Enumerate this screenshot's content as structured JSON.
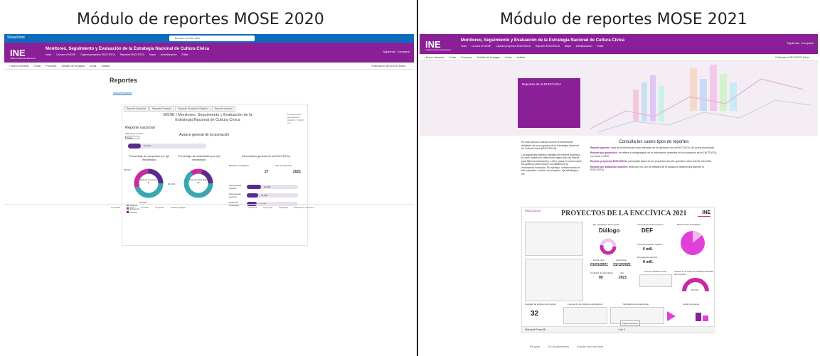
{
  "titles": {
    "left": "Módulo de reportes MOSE 2020",
    "right": "Módulo de reportes MOSE 2021"
  },
  "colors": {
    "purple": "#8a1f97",
    "blue": "#0f6cbd",
    "dark_purple": "#5a2b8a",
    "teal": "#3aa7b0",
    "magenta": "#c72ba0"
  },
  "left": {
    "brand": "SharePoint",
    "search_placeholder": "Buscar en este sitio",
    "header": {
      "logo": "INE",
      "logo_sub": "Instituto Nacional Electoral",
      "title": "Monitoreo, Seguimiento y Evaluación de la Estrategia Nacional de Cultura Cívica",
      "nav": [
        "Inicio",
        "Conoce el MOSE",
        "Captura proyectos ENCCÍVICA",
        "Reportes ENCCÍVICA",
        "Mapa",
        "Administración",
        "Editar"
      ],
      "right": [
        "Siguiendo",
        "Compartir"
      ]
    },
    "cmd": [
      "+ Nuevo elemento",
      "Enviar",
      "Promover",
      "Detalles de la página",
      "Iniciar",
      "Análisis"
    ],
    "cmd_right": "Publicado el 28/10/2021   Editar",
    "page_title": "Reportes",
    "back_link": "Inicio/Reportes",
    "tabs": [
      "Reporte Nacional",
      "Reporte Proyecto",
      "Reporte Población Objetivo",
      "Reporte Actores"
    ],
    "card_title": "MOSE | Monitoreo, Seguimiento y Evaluación de la Estrategia Nacional de Cultura Cívica",
    "card_ts": "Fecha/Hora de actualización 09/02/21 7:00:00 p.m.",
    "rn": "Reporte nacional",
    "sel_label": "Seleccione un año",
    "sel_value": "Todos",
    "avance": "Avance general de la operación",
    "avance_pct": "16.46%",
    "donut1_title": "Porcentaje de proyectos por eje estratégico",
    "donut1_center": "Total de proyectos",
    "donut1_num": "31",
    "donut2_title": "Porcentaje de actividades por eje estratégico",
    "donut2_center": "Total de actividades",
    "donut2_num": "62",
    "d1_labels": [
      "25.81%",
      "45.16%",
      "29.03%"
    ],
    "info_title": "Información general de la ENCCÍVICA",
    "info_h1": "Medición estratégica",
    "info_h2": "Año de operación",
    "info_v1": "27",
    "info_v2": "2021",
    "bars": [
      {
        "label": "Participantes directos",
        "value": "12,346"
      },
      {
        "label": "Presupuesto ejercido",
        "value": "13,986"
      },
      {
        "label": "Población alcanzada",
        "value": "14,099"
      }
    ],
    "legend": [
      "Diálogo",
      "Exigencia",
      "Verdad"
    ],
    "footer": [
      "Comentar",
      "Te gusta",
      "Guardar",
      "Compartir",
      "Publicar página"
    ],
    "footer_right": [
      "Informes",
      "Comparte",
      "Mensajes",
      "Elementos recientes"
    ]
  },
  "right": {
    "header": {
      "logo": "INE",
      "logo_sub": "Instituto Nacional Electoral",
      "title": "Monitoreo, Seguimiento y Evaluación de la Estrategia Nacional de Cultura Cívica",
      "nav": [
        "Inicio",
        "Conoce el MOSE",
        "Captura proyectos ENCCÍVICA",
        "Reportes ENCCÍVICA",
        "Mapa",
        "Administración",
        "Editar"
      ],
      "right": [
        "Siguiendo",
        "Compartir"
      ]
    },
    "cmd": [
      "+ Nuevo elemento",
      "Enviar",
      "Promover",
      "Detalles de la página",
      "Iniciar",
      "Análisis"
    ],
    "cmd_right": "Publicado el 28/10/2021   Editar",
    "hero_box": "Reportes de la ENCCÍVICA",
    "intro": "En esta sección podrás conocer la información detallada de los proyectos de la Estrategia Nacional de Cultura Cívica (ENCCÍVICA).",
    "intro2": "Los siguientes tableros trabajan de manera dinámica, es decir, basta con seleccionar algún dato de interés para filtrar la información, o bien, pasar el cursor sobre los gráficos para conocer los detalles de la información mostrada. Por ejemplo, seleccionando el año operativo, nombre del proyecto, eje estratégico, etc.",
    "consulta_title": "Consulta los cuatro tipos de reportes:",
    "items": [
      {
        "b": "Reporte general:",
        "t": "trata de la información más relevante de la operación de la ENCCÍVICA, de forma acumulada."
      },
      {
        "b": "Reporte por proyectos:",
        "t": "se refiere al desagregado de la información operativa de los proyectos de la ENCCÍVICA, con corte a 2020."
      },
      {
        "b": "Reporte proyectos ENCCÍVICA:",
        "t": "principales datos de los proyectos del año operativo más reciente año 2021."
      },
      {
        "b": "Reporte por población objetivo:",
        "t": "tiene que ver con los detalles de la población objetivo que atiende la ENCCÍVICA."
      }
    ],
    "pbi_title": "PROYECTOS DE LA ENCCÍVICA 2021",
    "pbi_logo": "ENCCÍVICA",
    "pbi_ine": "INE",
    "eje_label": "Eje estratégico del proyecto",
    "eje_val": "Diálogo",
    "area_label": "Área ejecutora del proyecto",
    "area_val": "DEF",
    "meta_label": "Metas de las actividades",
    "fecha_ini_label": "Fecha inicio",
    "fecha_ini": "01/01/2021",
    "fecha_fin_label": "Fecha final",
    "fecha_fin": "31/12/2021",
    "pob_label": "Total de población objetivo",
    "pob_val": "6 mill.",
    "pres_label": "Presupuesto ejercido",
    "pres_val": "8 mill.",
    "act_label": "Cantidad de actividades",
    "act_val": "99",
    "anio_label": "Año",
    "anio_val": "2021",
    "tipo_label": "Tipo de población meta",
    "avance_label": "Avance en la meta de población atendida del proyecto",
    "avance_val": "99.14%",
    "total_label": "Cantidad de actores del proyecto",
    "total_val": "32",
    "fuente_label": "Fuentes de los objetivos estratégicos",
    "ind_label": "Indicadores de desempeño",
    "cumpl_label": "Grado de Avance",
    "pbifoot": "Microsoft Power BI",
    "page": "1 de 4",
    "tip": "Página siguiente",
    "footer": [
      "Me gusta",
      "Sin visualizaciones",
      "Guardar para más tarde"
    ]
  }
}
